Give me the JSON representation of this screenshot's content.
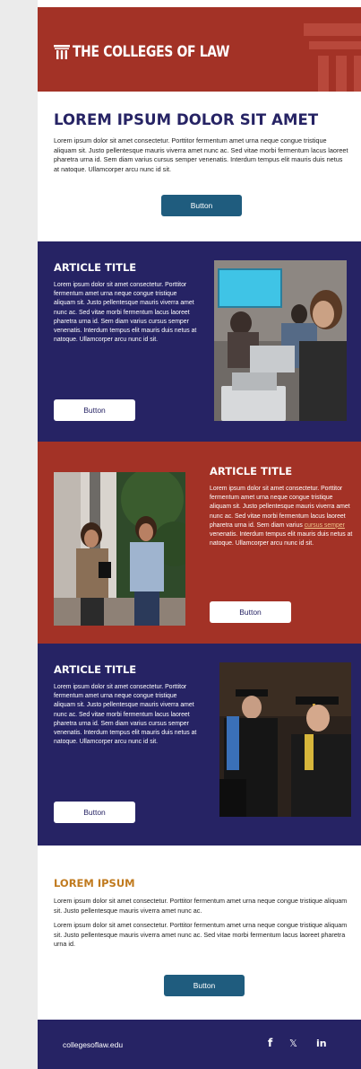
{
  "header": {
    "logo_text": "THE COLLEGES OF LAW"
  },
  "intro": {
    "title": "LOREM IPSUM DOLOR SIT AMET",
    "body": "Lorem ipsum dolor sit amet consectetur. Porttitor fermentum amet urna neque congue tristique aliquam sit. Justo pellentesque mauris viverra amet nunc ac. Sed vitae morbi fermentum lacus laoreet pharetra urna id. Sem diam varius cursus semper venenatis. Interdum tempus elit mauris duis netus at natoque. Ullamcorper arcu nunc id sit.",
    "button": "Button"
  },
  "articles": [
    {
      "title": "ARTICLE TITLE",
      "body": "Lorem ipsum dolor sit amet consectetur. Porttitor fermentum amet urna neque congue tristique aliquam sit. Justo pellentesque mauris viverra amet nunc ac. Sed vitae morbi fermentum lacus laoreet pharetra urna id. Sem diam varius cursus semper venenatis. Interdum tempus elit mauris duis netus at natoque. Ullamcorper arcu nunc id sit.",
      "button": "Button"
    },
    {
      "title": "ARTICLE TITLE",
      "body_before": "Lorem ipsum dolor sit amet consectetur. Porttitor fermentum amet urna neque congue tristique aliquam sit. Justo pellentesque mauris viverra amet nunc ac. Sed vitae morbi fermentum lacus laoreet pharetra urna id. Sem diam varius ",
      "link": "cursus semper",
      "body_after": " venenatis. Interdum tempus elit mauris duis netus at natoque. Ullamcorper arcu nunc id sit.",
      "button": "Button"
    },
    {
      "title": "ARTICLE TITLE",
      "body": "Lorem ipsum dolor sit amet consectetur. Porttitor fermentum amet urna neque congue tristique aliquam sit. Justo pellentesque mauris viverra amet nunc ac. Sed vitae morbi fermentum lacus laoreet pharetra urna id. Sem diam varius cursus semper venenatis. Interdum tempus elit mauris duis netus at natoque. Ullamcorper arcu nunc id sit.",
      "button": "Button"
    }
  ],
  "section": {
    "title": "LOREM IPSUM",
    "para1": "Lorem ipsum dolor sit amet consectetur. Porttitor fermentum amet urna neque congue tristique aliquam sit. Justo pellentesque mauris viverra amet nunc ac.",
    "para2": "Lorem ipsum dolor sit amet consectetur. Porttitor fermentum amet urna neque congue tristique aliquam sit. Justo pellentesque mauris viverra amet nunc ac. Sed vitae morbi fermentum lacus laoreet pharetra urna id.",
    "button": "Button"
  },
  "footer": {
    "url": "collegesoflaw.edu",
    "facebook": "f",
    "x": "𝕏",
    "linkedin": "in"
  },
  "colors": {
    "brand_red": "#a33226",
    "brand_navy": "#262364",
    "button_teal": "#1f5c7e",
    "accent_gold": "#c07a1e"
  },
  "icons": [
    "columns-logo-icon",
    "facebook-icon",
    "x-icon",
    "linkedin-icon"
  ]
}
